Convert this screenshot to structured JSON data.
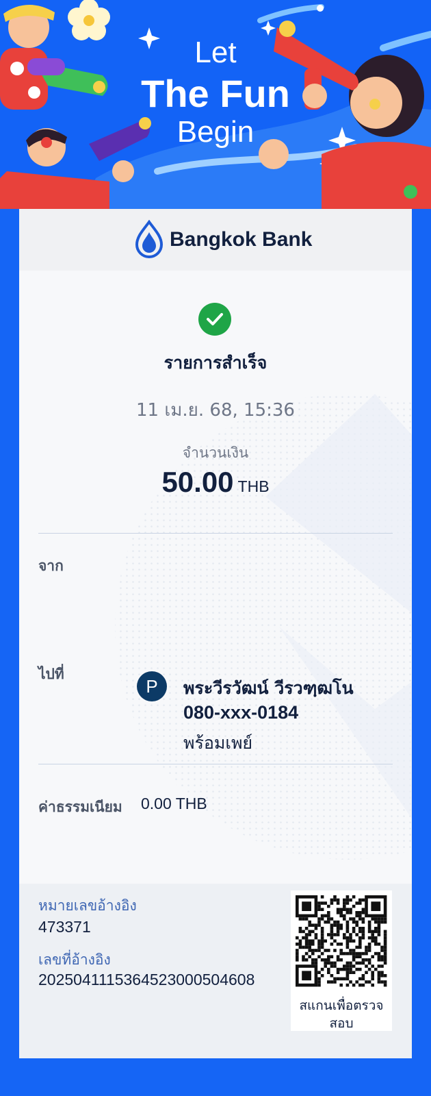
{
  "banner": {
    "line1": "Let",
    "line2": "The Fun",
    "line3": "Begin"
  },
  "bank": {
    "name": "Bangkok Bank",
    "brand_color": "#1e5bd6"
  },
  "transaction": {
    "status": "รายการสำเร็จ",
    "datetime": "11 เม.ย. 68, 15:36",
    "amount_label": "จำนวนเงิน",
    "amount": "50.00",
    "currency": "THB"
  },
  "from": {
    "label": "จาก"
  },
  "to": {
    "label": "ไปที่",
    "badge": "P",
    "name": "พระวีรวัฒน์ วีรวฑฺฒโน",
    "account": "080-xxx-0184",
    "service": "พร้อมเพย์"
  },
  "fee": {
    "label": "ค่าธรรมเนียม",
    "value": "0.00 THB"
  },
  "reference": {
    "number_label": "หมายเลขอ้างอิง",
    "number": "473371",
    "id_label": "เลขที่อ้างอิง",
    "id": "202504111536452300050460​8"
  },
  "qr": {
    "caption": "สแกนเพื่อตรวจสอบ"
  },
  "colors": {
    "page_bg": "#1565f5",
    "success": "#1fa547",
    "text_dark": "#12203e",
    "text_muted": "#6e7687",
    "link_label": "#3e66b3"
  }
}
